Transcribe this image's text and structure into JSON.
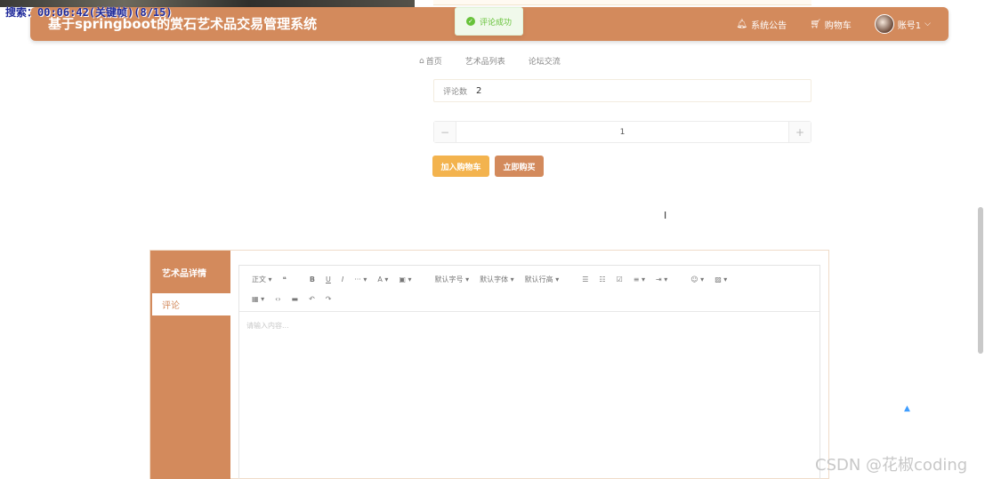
{
  "overlay": {
    "text": "搜索：00:06:42(关键帧)(8/15)"
  },
  "header": {
    "title": "基于springboot的赏石艺术品交易管理系统",
    "notice": "系统公告",
    "cart": "购物车",
    "account": "账号1"
  },
  "toast": {
    "text": "评论成功"
  },
  "nav": {
    "items": [
      "首页",
      "艺术品列表",
      "论坛交流"
    ]
  },
  "review": {
    "label": "评论数",
    "count": "2"
  },
  "quantity": {
    "minus": "−",
    "value": "1",
    "plus": "+"
  },
  "buttons": {
    "add_cart": "加入购物车",
    "buy_now": "立即购买"
  },
  "detail_tabs": {
    "detail": "艺术品详情",
    "comment": "评论"
  },
  "editor": {
    "toolbar_row1": [
      "正文 ▾",
      "❝",
      "B",
      "U",
      "I",
      "··· ▾",
      "A ▾",
      "▣ ▾",
      "默认字号 ▾",
      "默认字体 ▾",
      "默认行高 ▾",
      "☰",
      "☷",
      "☑",
      "≡ ▾",
      "⇥ ▾",
      "☺ ▾",
      "▨ ▾"
    ],
    "toolbar_row2": [
      "▦ ▾",
      "‹›",
      "▬",
      "↶",
      "↷"
    ],
    "placeholder": "请输入内容..."
  },
  "watermark": "CSDN @花椒coding",
  "colors": {
    "primary": "#d38a5c",
    "cart_btn": "#f3b34e",
    "success": "#67c23a"
  }
}
